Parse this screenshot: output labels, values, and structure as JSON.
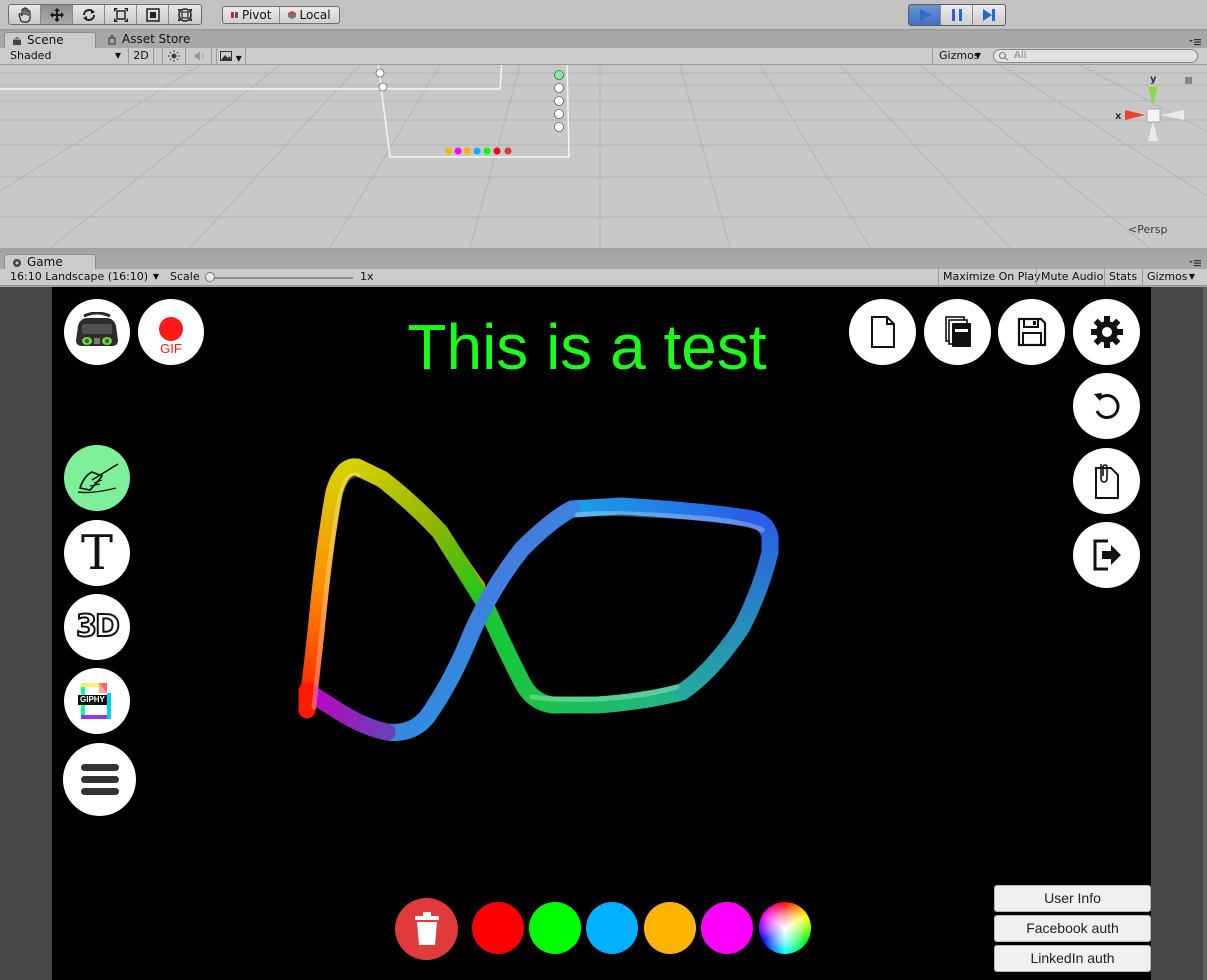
{
  "toolbar": {
    "pivot_label": "Pivot",
    "local_label": "Local",
    "tools": [
      "hand-icon",
      "move-icon",
      "rotate-icon",
      "scale-icon",
      "rect-tool-icon",
      "transform-icon"
    ],
    "play_controls": [
      "play-icon",
      "pause-icon",
      "step-icon"
    ]
  },
  "scene": {
    "tab_label": "Scene",
    "asset_store_tab_label": "Asset Store",
    "shading_mode": "Shaded",
    "mode_2d_label": "2D",
    "gizmos_label": "Gizmos",
    "search_placeholder": "All",
    "axis_y": "y",
    "axis_x": "x",
    "persp_label": "Persp"
  },
  "game": {
    "tab_label": "Game",
    "aspect": "16:10 Landscape (16:10)",
    "scale_label": "Scale",
    "scale_value": "1x",
    "scale_fraction": 0.02,
    "maximize_label": "Maximize On Play",
    "mute_label": "Mute Audio",
    "stats_label": "Stats",
    "gizmos_label": "Gizmos"
  },
  "app": {
    "title_text": "This is a test",
    "gif_label": "GIF",
    "giphy_label": "GIPHY",
    "text_tool_label": "T",
    "three_d_label": "3D",
    "left_tools": [
      "vr-headset-icon",
      "record-gif-icon",
      "draw-tool-icon",
      "text-tool-icon",
      "3d-tool-icon",
      "giphy-icon",
      "menu-icon"
    ],
    "right_tools": [
      "new-file-icon",
      "open-files-icon",
      "save-icon",
      "settings-icon",
      "undo-icon",
      "clipboard-icon",
      "exit-icon"
    ],
    "auth_buttons": [
      "User Info",
      "Facebook auth",
      "LinkedIn auth"
    ],
    "palette": [
      {
        "name": "red",
        "color": "#ff0000"
      },
      {
        "name": "green",
        "color": "#00ff00"
      },
      {
        "name": "cyan",
        "color": "#00b0ff"
      },
      {
        "name": "orange",
        "color": "#ffb400"
      },
      {
        "name": "magenta",
        "color": "#ff00ff"
      }
    ],
    "delete_color": "#e03a3a",
    "draw_tool_active_color": "#7ff09a",
    "title_color": "#19ff19"
  }
}
